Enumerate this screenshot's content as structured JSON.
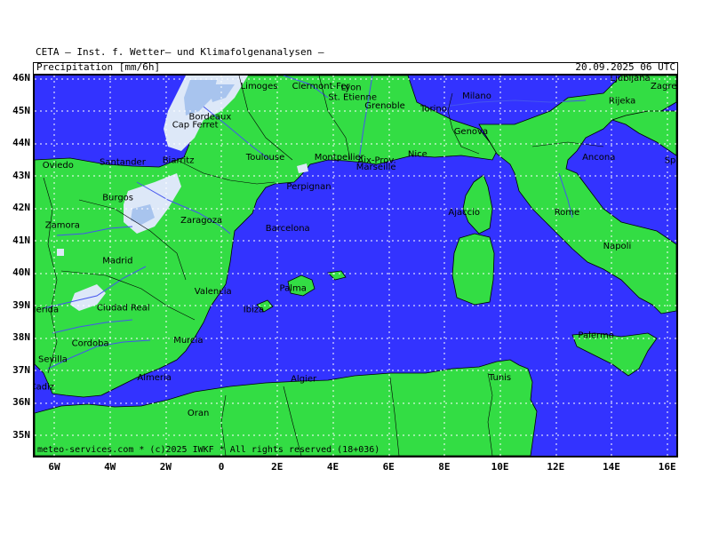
{
  "header": {
    "source": "CETA — Inst. f. Wetter— und Klimafolgenanalysen —",
    "parameter": "Precipitation [mm/6h]",
    "datetime": "20.09.2025 06 UTC"
  },
  "footer": {
    "credit": "meteo-services.com * (c)2025 IWKF * All rights reserved (18+036)"
  },
  "axes": {
    "lat_labels": [
      "46N",
      "45N",
      "44N",
      "43N",
      "42N",
      "41N",
      "40N",
      "39N",
      "38N",
      "37N",
      "36N",
      "35N"
    ],
    "lon_labels": [
      "6W",
      "4W",
      "2W",
      "0",
      "2E",
      "4E",
      "6E",
      "8E",
      "10E",
      "12E",
      "14E",
      "16E"
    ]
  },
  "colors": {
    "sea": "#3333ff",
    "land": "#33dd44",
    "precip_light": "#dde8f8",
    "precip_medium": "#a8c4ee",
    "grid": "#ffffff",
    "borders": "#000000",
    "rivers": "#4455ee"
  },
  "cities": [
    {
      "name": "Clermont-Fer",
      "lon": 3.1,
      "lat": 45.8
    },
    {
      "name": "Limoges",
      "lon": 1.25,
      "lat": 45.8
    },
    {
      "name": "Lyon",
      "lon": 4.85,
      "lat": 45.75
    },
    {
      "name": "St. Etienne",
      "lon": 4.4,
      "lat": 45.45
    },
    {
      "name": "Grenoble",
      "lon": 5.7,
      "lat": 45.2
    },
    {
      "name": "Torino",
      "lon": 7.7,
      "lat": 45.1
    },
    {
      "name": "Milano",
      "lon": 9.2,
      "lat": 45.5
    },
    {
      "name": "Genova",
      "lon": 8.9,
      "lat": 44.4
    },
    {
      "name": "Bordeaux",
      "lon": -0.6,
      "lat": 44.85
    },
    {
      "name": "Cap Ferret",
      "lon": -1.2,
      "lat": 44.6
    },
    {
      "name": "Montpellier",
      "lon": 3.9,
      "lat": 43.6
    },
    {
      "name": "Toulouse",
      "lon": 1.45,
      "lat": 43.6
    },
    {
      "name": "Nice",
      "lon": 7.25,
      "lat": 43.7
    },
    {
      "name": "Aix-Prov.",
      "lon": 5.45,
      "lat": 43.5
    },
    {
      "name": "Marseille",
      "lon": 5.4,
      "lat": 43.3
    },
    {
      "name": "Biarritz",
      "lon": -1.55,
      "lat": 43.5
    },
    {
      "name": "Perpignan",
      "lon": 2.9,
      "lat": 42.7
    },
    {
      "name": "Oviedo",
      "lon": -5.85,
      "lat": 43.35
    },
    {
      "name": "Santander",
      "lon": -3.8,
      "lat": 43.45
    },
    {
      "name": "Burgos",
      "lon": -3.7,
      "lat": 42.35
    },
    {
      "name": "Zaragoza",
      "lon": -0.9,
      "lat": 41.65
    },
    {
      "name": "Barcelona",
      "lon": 2.15,
      "lat": 41.4
    },
    {
      "name": "Zamora",
      "lon": -5.75,
      "lat": 41.5
    },
    {
      "name": "Madrid",
      "lon": -3.7,
      "lat": 40.4
    },
    {
      "name": "Valencia",
      "lon": -0.4,
      "lat": 39.45
    },
    {
      "name": "Merida",
      "lon": -6.35,
      "lat": 38.9
    },
    {
      "name": "Ciudad Real",
      "lon": -3.9,
      "lat": 38.95
    },
    {
      "name": "Murcia",
      "lon": -1.15,
      "lat": 37.95
    },
    {
      "name": "Cordoba",
      "lon": -4.8,
      "lat": 37.85
    },
    {
      "name": "Sevilla",
      "lon": -6.0,
      "lat": 37.35
    },
    {
      "name": "Almeria",
      "lon": -2.45,
      "lat": 36.8
    },
    {
      "name": "Cadiz",
      "lon": -6.3,
      "lat": 36.5
    },
    {
      "name": "Ibiza",
      "lon": 1.35,
      "lat": 38.9
    },
    {
      "name": "Palma",
      "lon": 2.65,
      "lat": 39.55
    },
    {
      "name": "Ajaccio",
      "lon": 8.7,
      "lat": 41.9
    },
    {
      "name": "Rome",
      "lon": 12.5,
      "lat": 41.9
    },
    {
      "name": "Napoli",
      "lon": 14.25,
      "lat": 40.85
    },
    {
      "name": "Ancona",
      "lon": 13.5,
      "lat": 43.6
    },
    {
      "name": "Split",
      "lon": 16.45,
      "lat": 43.5
    },
    {
      "name": "Palermo",
      "lon": 13.35,
      "lat": 38.1
    },
    {
      "name": "Algier",
      "lon": 3.05,
      "lat": 36.75
    },
    {
      "name": "Tunis",
      "lon": 10.15,
      "lat": 36.8
    },
    {
      "name": "Oran",
      "lon": -0.65,
      "lat": 35.7
    },
    {
      "name": "Ljubljana",
      "lon": 14.5,
      "lat": 46.05
    },
    {
      "name": "Zagreb",
      "lon": 15.95,
      "lat": 45.8
    },
    {
      "name": "Rijeka",
      "lon": 14.45,
      "lat": 45.35
    }
  ]
}
